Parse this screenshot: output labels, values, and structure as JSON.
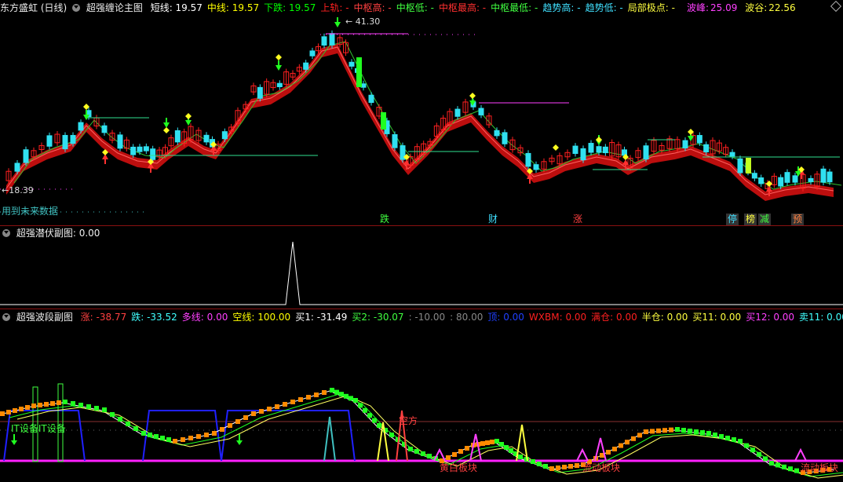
{
  "main": {
    "title": "东方盛虹 (日线)",
    "indicator": "超强缠论主图",
    "items": [
      {
        "label": "短线:",
        "value": "19.57",
        "color": "#ffffff"
      },
      {
        "label": "中线:",
        "value": "19.57",
        "color": "#ffff00"
      },
      {
        "label": "下跌:",
        "value": "19.57",
        "color": "#00ff00"
      },
      {
        "label": "上轨:",
        "value": "-",
        "color": "#ff2020"
      },
      {
        "label": "中枢高:",
        "value": "-",
        "color": "#ff4040"
      },
      {
        "label": "中枢低:",
        "value": "-",
        "color": "#40ff40"
      },
      {
        "label": "中枢最高:",
        "value": "-",
        "color": "#ff3030"
      },
      {
        "label": "中枢最低:",
        "value": "-",
        "color": "#40ff40"
      },
      {
        "label": "趋势高:",
        "value": "-",
        "color": "#40e0ff"
      },
      {
        "label": "趋势低:",
        "value": "-",
        "color": "#40e0ff"
      },
      {
        "label": "局部极点:",
        "value": "-",
        "color": "#ffff40"
      }
    ],
    "wave_peak": {
      "label": "波峰:",
      "value": "25.09"
    },
    "wave_valley": {
      "label": "波谷:",
      "value": "22.56"
    },
    "price_high": "41.30",
    "price_low": "18.39",
    "future_note": "用到未来数据",
    "signals": [
      "跌",
      "财",
      "涨",
      "停",
      "榜",
      "减",
      "预"
    ]
  },
  "sub1": {
    "indicator": "超强潜伏副图",
    "value": ": 0.00"
  },
  "sub2": {
    "indicator": "超强波段副图",
    "items": [
      {
        "label": "涨:",
        "value": "-38.77",
        "color": "#ff4040"
      },
      {
        "label": "跌:",
        "value": "-33.52",
        "color": "#40ffff"
      },
      {
        "label": "多线:",
        "value": "0.00",
        "color": "#ff40ff"
      },
      {
        "label": "空线:",
        "value": "100.00",
        "color": "#ffff00"
      },
      {
        "label": "买1:",
        "value": "-31.49",
        "color": "#ffffff"
      },
      {
        "label": "买2:",
        "value": "-30.07",
        "color": "#40ff40"
      },
      {
        "label": ":",
        "value": "-10.00",
        "color": "#888888"
      },
      {
        "label": ":",
        "value": "80.00",
        "color": "#888888"
      },
      {
        "label": "顶:",
        "value": "0.00",
        "color": "#2040ff"
      },
      {
        "label": "WXBM:",
        "value": "0.00",
        "color": "#ff2020"
      },
      {
        "label": "满仓:",
        "value": "0.00",
        "color": "#ff2020"
      },
      {
        "label": "半仓:",
        "value": "0.00",
        "color": "#ffff40"
      },
      {
        "label": "买11:",
        "value": "0.00",
        "color": "#ffff40"
      },
      {
        "label": "买12:",
        "value": "0.00",
        "color": "#ff40ff"
      },
      {
        "label": "卖11:",
        "value": "0.00",
        "color": "#40ffff"
      }
    ],
    "labels": [
      "IT设备IT设备",
      "空方",
      "黄白板块",
      "流动板块",
      "流动板块"
    ]
  }
}
